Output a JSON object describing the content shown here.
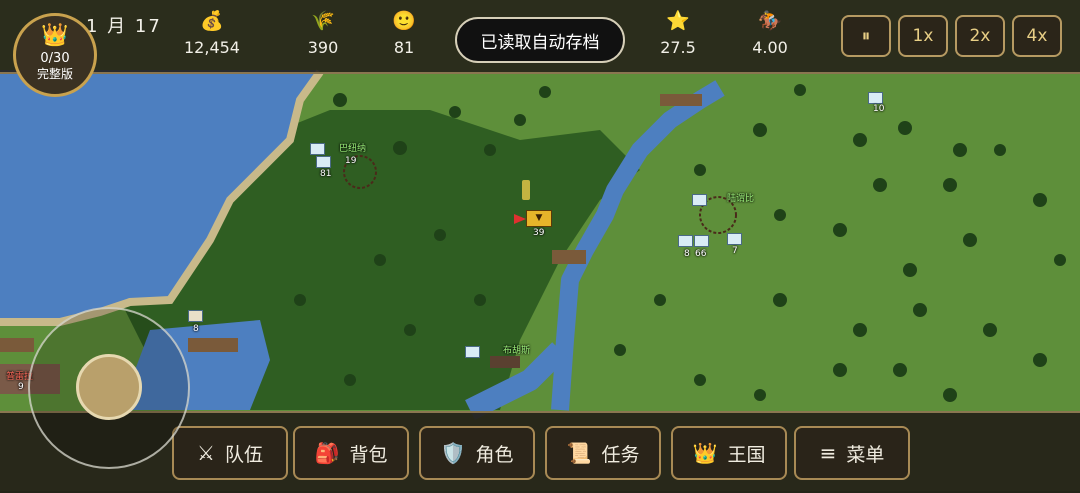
{
  "header": {
    "date": "1 月 17",
    "stats": [
      {
        "icon": "money-bag-icon",
        "glyph": "💰",
        "value": "12,454"
      },
      {
        "icon": "wheat-icon",
        "glyph": "🌾",
        "value": "390"
      },
      {
        "icon": "smiley-icon",
        "glyph": "🙂",
        "value": "81"
      },
      {
        "icon": "star-icon",
        "glyph": "⭐",
        "value": "27.5"
      },
      {
        "icon": "horse-rider-icon",
        "glyph": "🏇",
        "value": "4.00"
      }
    ],
    "toast": "已读取自动存档",
    "speed_buttons": [
      "⏸",
      "1x",
      "2x",
      "4x"
    ]
  },
  "badge": {
    "crown_glyph": "👑",
    "count": "0/30",
    "label": "完整版"
  },
  "bottom_menu": [
    {
      "icon": "swords-icon",
      "glyph": "⚔",
      "label": "队伍"
    },
    {
      "icon": "backpack-icon",
      "glyph": "🎒",
      "label": "背包"
    },
    {
      "icon": "shield-icon",
      "glyph": "🛡️",
      "label": "角色"
    },
    {
      "icon": "scroll-icon",
      "glyph": "📜",
      "label": "任务"
    },
    {
      "icon": "crown-icon",
      "glyph": "👑",
      "label": "王国"
    },
    {
      "icon": "hamburger-icon",
      "glyph": "≡",
      "label": "菜单"
    }
  ],
  "map": {
    "player_level": "39",
    "labels": {
      "town_west_name": "巴纽纳",
      "town_west_size": "19",
      "party_west_size": "81",
      "town_east_name": "陆谓比",
      "party_east_a": "8",
      "party_east_b": "66",
      "party_east_c": "7",
      "party_ne": "10",
      "village_south_name": "布胡斯",
      "party_sw": "8",
      "enemy_town_name": "普雷拉",
      "enemy_town_size": "9"
    },
    "colors": {
      "water": "#4d7fc0",
      "grass_dark": "#2f5e22",
      "grass_light": "#5e8f3a",
      "sand": "#c8b98a"
    }
  }
}
